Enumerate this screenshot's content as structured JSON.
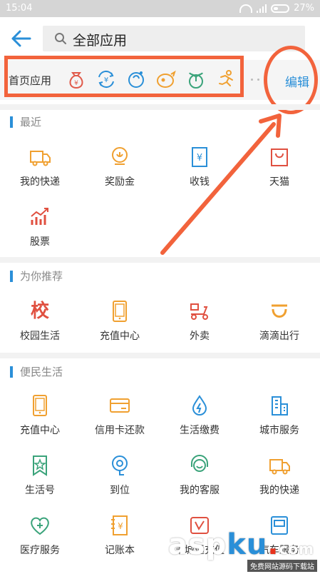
{
  "statusbar": {
    "time": "15:04",
    "battery": "27%"
  },
  "header": {
    "search_text": "全部应用"
  },
  "home_apps": {
    "label": "首页应用",
    "icons": [
      "money-bag-icon",
      "exchange-icon",
      "balloon-icon",
      "chick-icon",
      "sprout-icon",
      "runner-icon"
    ],
    "edit_label": "编辑"
  },
  "sections": {
    "recent": {
      "title": "最近",
      "items": [
        "我的快递",
        "奖励金",
        "收钱",
        "天猫",
        "股票"
      ]
    },
    "recommend": {
      "title": "为你推荐",
      "items": [
        "校园生活",
        "充值中心",
        "外卖",
        "滴滴出行"
      ],
      "campus_glyph": "校"
    },
    "life": {
      "title": "便民生活",
      "items": [
        "充值中心",
        "信用卡还款",
        "生活缴费",
        "城市服务",
        "生活号",
        "到位",
        "我的客服",
        "我的快递",
        "医疗服务",
        "记账本",
        "羊城通充值",
        "汽车服务"
      ]
    }
  },
  "watermark": {
    "text": "asp",
    "ku": "ku",
    "dot": ".",
    "com": "com",
    "sub": "免费网站源码下载站"
  },
  "colors": {
    "accent": "#2a8fd8",
    "orange": "#f0a030",
    "red": "#e05040",
    "annotation": "#f2633c"
  }
}
